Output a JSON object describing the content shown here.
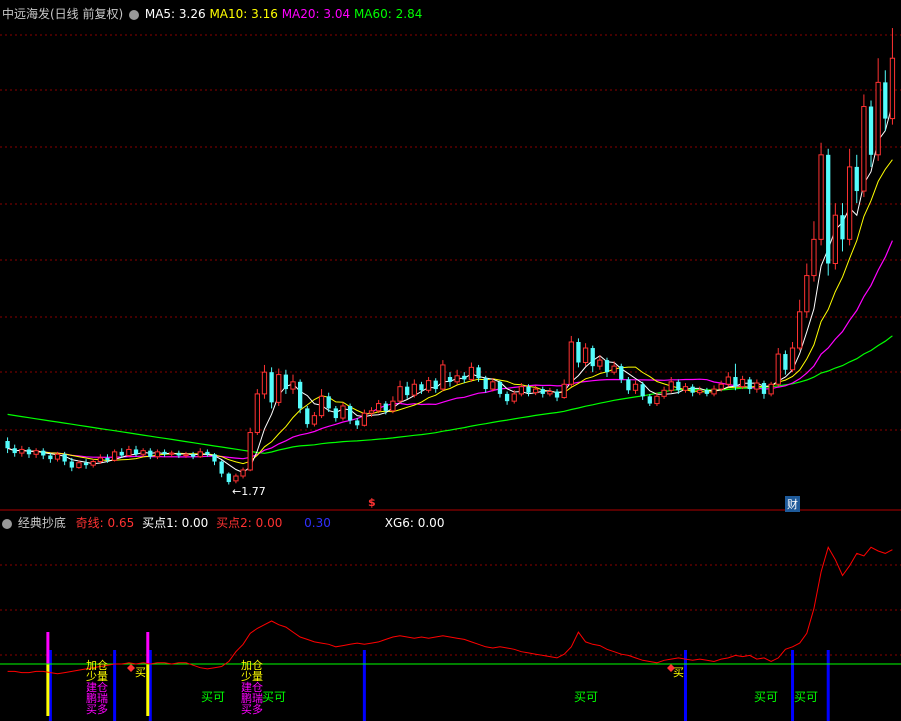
{
  "main_header": {
    "stock": "中远海发(日线 前复权)",
    "ma5": "MA5: 3.26",
    "ma10": "MA10: 3.16",
    "ma20": "MA20: 3.04",
    "ma60": "MA60: 2.84",
    "low_label": "←1.77",
    "s_marker": "$",
    "cai_marker": "财"
  },
  "sub_header": {
    "title": "经典抄底",
    "qixian": "奇线: 0.65",
    "buy1": "买点1: 0.00",
    "buy2": "买点2: 0.00",
    "v030": "0.30",
    "xg6": "XG6: 0.00"
  },
  "signals": {
    "maike": "买可",
    "mai": "买",
    "jiacang": "加仓",
    "shaoliang": "少量",
    "jiancang": "建仓",
    "pengrui": "鹏瑞",
    "maiduo": "买多"
  },
  "colors": {
    "up": "#ff3232",
    "down": "#54fcfc",
    "ma5": "#ffffff",
    "ma10": "#ffff00",
    "ma20": "#ff00ff",
    "ma60": "#00ff00",
    "grid": "#8a0000",
    "redline": "#ff0000"
  },
  "chart_data": {
    "type": "candlestick",
    "price_range": [
      1.6,
      5.6
    ],
    "low_marked": 1.77,
    "candles": [
      {
        "o": 2.13,
        "c": 2.07,
        "h": 2.16,
        "l": 2.03
      },
      {
        "o": 2.07,
        "c": 2.03,
        "h": 2.1,
        "l": 2.0
      },
      {
        "o": 2.03,
        "c": 2.06,
        "h": 2.09,
        "l": 2.0
      },
      {
        "o": 2.06,
        "c": 2.02,
        "h": 2.08,
        "l": 1.99
      },
      {
        "o": 2.02,
        "c": 2.05,
        "h": 2.07,
        "l": 1.99
      },
      {
        "o": 2.05,
        "c": 2.01,
        "h": 2.07,
        "l": 1.98
      },
      {
        "o": 2.01,
        "c": 1.98,
        "h": 2.03,
        "l": 1.95
      },
      {
        "o": 1.98,
        "c": 2.02,
        "h": 2.04,
        "l": 1.96
      },
      {
        "o": 2.02,
        "c": 1.96,
        "h": 2.04,
        "l": 1.93
      },
      {
        "o": 1.96,
        "c": 1.91,
        "h": 1.99,
        "l": 1.88
      },
      {
        "o": 1.91,
        "c": 1.95,
        "h": 1.97,
        "l": 1.9
      },
      {
        "o": 1.95,
        "c": 1.93,
        "h": 1.98,
        "l": 1.9
      },
      {
        "o": 1.93,
        "c": 1.96,
        "h": 1.98,
        "l": 1.91
      },
      {
        "o": 1.96,
        "c": 1.99,
        "h": 2.02,
        "l": 1.94
      },
      {
        "o": 1.99,
        "c": 1.97,
        "h": 2.02,
        "l": 1.95
      },
      {
        "o": 1.97,
        "c": 2.04,
        "h": 2.06,
        "l": 1.96
      },
      {
        "o": 2.04,
        "c": 2.01,
        "h": 2.07,
        "l": 1.99
      },
      {
        "o": 2.01,
        "c": 2.06,
        "h": 2.09,
        "l": 2.0
      },
      {
        "o": 2.06,
        "c": 2.02,
        "h": 2.09,
        "l": 2.0
      },
      {
        "o": 2.02,
        "c": 2.05,
        "h": 2.07,
        "l": 2.0
      },
      {
        "o": 2.05,
        "c": 2.0,
        "h": 2.07,
        "l": 1.98
      },
      {
        "o": 2.0,
        "c": 2.04,
        "h": 2.06,
        "l": 1.98
      },
      {
        "o": 2.04,
        "c": 2.02,
        "h": 2.06,
        "l": 2.0
      },
      {
        "o": 2.02,
        "c": 2.03,
        "h": 2.05,
        "l": 2.0
      },
      {
        "o": 2.03,
        "c": 2.01,
        "h": 2.05,
        "l": 1.99
      },
      {
        "o": 2.01,
        "c": 2.02,
        "h": 2.04,
        "l": 1.99
      },
      {
        "o": 2.02,
        "c": 2.0,
        "h": 2.04,
        "l": 1.98
      },
      {
        "o": 2.0,
        "c": 2.04,
        "h": 2.07,
        "l": 1.99
      },
      {
        "o": 2.04,
        "c": 2.02,
        "h": 2.06,
        "l": 2.0
      },
      {
        "o": 2.02,
        "c": 1.96,
        "h": 2.03,
        "l": 1.93
      },
      {
        "o": 1.96,
        "c": 1.86,
        "h": 1.97,
        "l": 1.83
      },
      {
        "o": 1.86,
        "c": 1.79,
        "h": 1.87,
        "l": 1.77
      },
      {
        "o": 1.8,
        "c": 1.84,
        "h": 1.86,
        "l": 1.78
      },
      {
        "o": 1.84,
        "c": 1.89,
        "h": 1.91,
        "l": 1.82
      },
      {
        "o": 1.89,
        "c": 2.2,
        "h": 2.24,
        "l": 1.88
      },
      {
        "o": 2.2,
        "c": 2.52,
        "h": 2.56,
        "l": 2.18
      },
      {
        "o": 2.52,
        "c": 2.7,
        "h": 2.76,
        "l": 2.48
      },
      {
        "o": 2.7,
        "c": 2.45,
        "h": 2.74,
        "l": 2.4
      },
      {
        "o": 2.45,
        "c": 2.68,
        "h": 2.73,
        "l": 2.42
      },
      {
        "o": 2.68,
        "c": 2.56,
        "h": 2.72,
        "l": 2.52
      },
      {
        "o": 2.56,
        "c": 2.62,
        "h": 2.68,
        "l": 2.52
      },
      {
        "o": 2.62,
        "c": 2.4,
        "h": 2.64,
        "l": 2.36
      },
      {
        "o": 2.4,
        "c": 2.27,
        "h": 2.42,
        "l": 2.24
      },
      {
        "o": 2.27,
        "c": 2.34,
        "h": 2.37,
        "l": 2.25
      },
      {
        "o": 2.34,
        "c": 2.5,
        "h": 2.56,
        "l": 2.32
      },
      {
        "o": 2.5,
        "c": 2.4,
        "h": 2.53,
        "l": 2.37
      },
      {
        "o": 2.4,
        "c": 2.32,
        "h": 2.42,
        "l": 2.29
      },
      {
        "o": 2.32,
        "c": 2.42,
        "h": 2.45,
        "l": 2.3
      },
      {
        "o": 2.42,
        "c": 2.3,
        "h": 2.44,
        "l": 2.27
      },
      {
        "o": 2.3,
        "c": 2.26,
        "h": 2.32,
        "l": 2.23
      },
      {
        "o": 2.26,
        "c": 2.36,
        "h": 2.39,
        "l": 2.25
      },
      {
        "o": 2.36,
        "c": 2.38,
        "h": 2.41,
        "l": 2.33
      },
      {
        "o": 2.38,
        "c": 2.44,
        "h": 2.47,
        "l": 2.36
      },
      {
        "o": 2.44,
        "c": 2.38,
        "h": 2.46,
        "l": 2.35
      },
      {
        "o": 2.38,
        "c": 2.46,
        "h": 2.5,
        "l": 2.36
      },
      {
        "o": 2.46,
        "c": 2.58,
        "h": 2.63,
        "l": 2.44
      },
      {
        "o": 2.58,
        "c": 2.51,
        "h": 2.62,
        "l": 2.48
      },
      {
        "o": 2.51,
        "c": 2.6,
        "h": 2.64,
        "l": 2.49
      },
      {
        "o": 2.6,
        "c": 2.55,
        "h": 2.62,
        "l": 2.52
      },
      {
        "o": 2.55,
        "c": 2.63,
        "h": 2.66,
        "l": 2.53
      },
      {
        "o": 2.63,
        "c": 2.56,
        "h": 2.65,
        "l": 2.53
      },
      {
        "o": 2.56,
        "c": 2.76,
        "h": 2.8,
        "l": 2.54
      },
      {
        "o": 2.66,
        "c": 2.62,
        "h": 2.7,
        "l": 2.58
      },
      {
        "o": 2.62,
        "c": 2.67,
        "h": 2.72,
        "l": 2.6
      },
      {
        "o": 2.67,
        "c": 2.64,
        "h": 2.7,
        "l": 2.61
      },
      {
        "o": 2.64,
        "c": 2.74,
        "h": 2.78,
        "l": 2.62
      },
      {
        "o": 2.74,
        "c": 2.65,
        "h": 2.76,
        "l": 2.62
      },
      {
        "o": 2.65,
        "c": 2.56,
        "h": 2.67,
        "l": 2.53
      },
      {
        "o": 2.56,
        "c": 2.62,
        "h": 2.65,
        "l": 2.54
      },
      {
        "o": 2.62,
        "c": 2.52,
        "h": 2.63,
        "l": 2.49
      },
      {
        "o": 2.52,
        "c": 2.46,
        "h": 2.54,
        "l": 2.43
      },
      {
        "o": 2.46,
        "c": 2.52,
        "h": 2.55,
        "l": 2.44
      },
      {
        "o": 2.52,
        "c": 2.58,
        "h": 2.61,
        "l": 2.5
      },
      {
        "o": 2.58,
        "c": 2.53,
        "h": 2.6,
        "l": 2.5
      },
      {
        "o": 2.53,
        "c": 2.56,
        "h": 2.59,
        "l": 2.51
      },
      {
        "o": 2.56,
        "c": 2.52,
        "h": 2.58,
        "l": 2.49
      },
      {
        "o": 2.52,
        "c": 2.54,
        "h": 2.57,
        "l": 2.5
      },
      {
        "o": 2.54,
        "c": 2.49,
        "h": 2.56,
        "l": 2.46
      },
      {
        "o": 2.49,
        "c": 2.6,
        "h": 2.64,
        "l": 2.48
      },
      {
        "o": 2.6,
        "c": 2.95,
        "h": 3.0,
        "l": 2.58
      },
      {
        "o": 2.95,
        "c": 2.78,
        "h": 2.98,
        "l": 2.74
      },
      {
        "o": 2.78,
        "c": 2.9,
        "h": 2.94,
        "l": 2.75
      },
      {
        "o": 2.9,
        "c": 2.75,
        "h": 2.92,
        "l": 2.7
      },
      {
        "o": 2.75,
        "c": 2.8,
        "h": 2.84,
        "l": 2.72
      },
      {
        "o": 2.8,
        "c": 2.7,
        "h": 2.82,
        "l": 2.66
      },
      {
        "o": 2.7,
        "c": 2.75,
        "h": 2.79,
        "l": 2.68
      },
      {
        "o": 2.75,
        "c": 2.64,
        "h": 2.77,
        "l": 2.61
      },
      {
        "o": 2.64,
        "c": 2.55,
        "h": 2.66,
        "l": 2.52
      },
      {
        "o": 2.55,
        "c": 2.6,
        "h": 2.63,
        "l": 2.52
      },
      {
        "o": 2.6,
        "c": 2.5,
        "h": 2.62,
        "l": 2.47
      },
      {
        "o": 2.5,
        "c": 2.44,
        "h": 2.52,
        "l": 2.42
      },
      {
        "o": 2.44,
        "c": 2.5,
        "h": 2.53,
        "l": 2.42
      },
      {
        "o": 2.5,
        "c": 2.55,
        "h": 2.58,
        "l": 2.48
      },
      {
        "o": 2.55,
        "c": 2.62,
        "h": 2.66,
        "l": 2.53
      },
      {
        "o": 2.62,
        "c": 2.55,
        "h": 2.64,
        "l": 2.52
      },
      {
        "o": 2.55,
        "c": 2.58,
        "h": 2.61,
        "l": 2.53
      },
      {
        "o": 2.58,
        "c": 2.53,
        "h": 2.6,
        "l": 2.5
      },
      {
        "o": 2.53,
        "c": 2.55,
        "h": 2.58,
        "l": 2.51
      },
      {
        "o": 2.55,
        "c": 2.52,
        "h": 2.57,
        "l": 2.5
      },
      {
        "o": 2.52,
        "c": 2.56,
        "h": 2.59,
        "l": 2.5
      },
      {
        "o": 2.56,
        "c": 2.6,
        "h": 2.63,
        "l": 2.54
      },
      {
        "o": 2.6,
        "c": 2.66,
        "h": 2.7,
        "l": 2.58
      },
      {
        "o": 2.66,
        "c": 2.58,
        "h": 2.77,
        "l": 2.55
      },
      {
        "o": 2.58,
        "c": 2.64,
        "h": 2.67,
        "l": 2.56
      },
      {
        "o": 2.64,
        "c": 2.56,
        "h": 2.66,
        "l": 2.52
      },
      {
        "o": 2.56,
        "c": 2.61,
        "h": 2.64,
        "l": 2.53
      },
      {
        "o": 2.61,
        "c": 2.52,
        "h": 2.63,
        "l": 2.48
      },
      {
        "o": 2.52,
        "c": 2.6,
        "h": 2.62,
        "l": 2.5
      },
      {
        "o": 2.6,
        "c": 2.85,
        "h": 2.9,
        "l": 2.58
      },
      {
        "o": 2.85,
        "c": 2.72,
        "h": 2.88,
        "l": 2.68
      },
      {
        "o": 2.72,
        "c": 2.9,
        "h": 2.95,
        "l": 2.7
      },
      {
        "o": 2.9,
        "c": 3.2,
        "h": 3.3,
        "l": 2.88
      },
      {
        "o": 3.2,
        "c": 3.5,
        "h": 3.6,
        "l": 3.15
      },
      {
        "o": 3.5,
        "c": 3.8,
        "h": 3.95,
        "l": 3.45
      },
      {
        "o": 3.8,
        "c": 4.5,
        "h": 4.6,
        "l": 3.75
      },
      {
        "o": 4.5,
        "c": 3.6,
        "h": 4.55,
        "l": 3.5
      },
      {
        "o": 3.6,
        "c": 4.0,
        "h": 4.1,
        "l": 3.55
      },
      {
        "o": 4.0,
        "c": 3.8,
        "h": 4.1,
        "l": 3.7
      },
      {
        "o": 3.8,
        "c": 4.4,
        "h": 4.55,
        "l": 3.75
      },
      {
        "o": 4.4,
        "c": 4.2,
        "h": 4.5,
        "l": 4.1
      },
      {
        "o": 4.2,
        "c": 4.9,
        "h": 5.0,
        "l": 4.15
      },
      {
        "o": 4.9,
        "c": 4.5,
        "h": 4.95,
        "l": 4.4
      },
      {
        "o": 4.5,
        "c": 5.1,
        "h": 5.3,
        "l": 4.45
      },
      {
        "o": 5.1,
        "c": 4.8,
        "h": 5.2,
        "l": 4.7
      },
      {
        "o": 4.8,
        "c": 5.3,
        "h": 5.55,
        "l": 4.75
      }
    ],
    "indicator": {
      "values": [
        0.14,
        0.14,
        0.13,
        0.13,
        0.14,
        0.14,
        0.13,
        0.12,
        0.13,
        0.14,
        0.15,
        0.16,
        0.17,
        0.18,
        0.19,
        0.2,
        0.2,
        0.21,
        0.2,
        0.21,
        0.2,
        0.21,
        0.21,
        0.2,
        0.21,
        0.21,
        0.19,
        0.17,
        0.16,
        0.17,
        0.18,
        0.22,
        0.3,
        0.36,
        0.45,
        0.49,
        0.52,
        0.55,
        0.52,
        0.5,
        0.46,
        0.42,
        0.4,
        0.38,
        0.37,
        0.36,
        0.34,
        0.35,
        0.36,
        0.37,
        0.36,
        0.37,
        0.38,
        0.4,
        0.42,
        0.43,
        0.42,
        0.41,
        0.42,
        0.41,
        0.42,
        0.43,
        0.42,
        0.41,
        0.4,
        0.38,
        0.36,
        0.34,
        0.33,
        0.34,
        0.33,
        0.32,
        0.3,
        0.29,
        0.28,
        0.27,
        0.26,
        0.25,
        0.28,
        0.34,
        0.46,
        0.38,
        0.36,
        0.35,
        0.32,
        0.3,
        0.28,
        0.27,
        0.25,
        0.23,
        0.22,
        0.21,
        0.23,
        0.24,
        0.25,
        0.24,
        0.23,
        0.24,
        0.23,
        0.22,
        0.24,
        0.25,
        0.27,
        0.26,
        0.27,
        0.24,
        0.25,
        0.22,
        0.25,
        0.32,
        0.34,
        0.37,
        0.45,
        0.65,
        0.95,
        1.15,
        1.05,
        0.92,
        1.0,
        1.1,
        1.08,
        1.15,
        1.12,
        1.1,
        1.13
      ],
      "threshold": 0.2,
      "buy_bars": [
        6,
        15,
        20,
        50,
        95,
        110,
        115
      ],
      "magenta_bars": [
        6,
        20
      ]
    }
  }
}
